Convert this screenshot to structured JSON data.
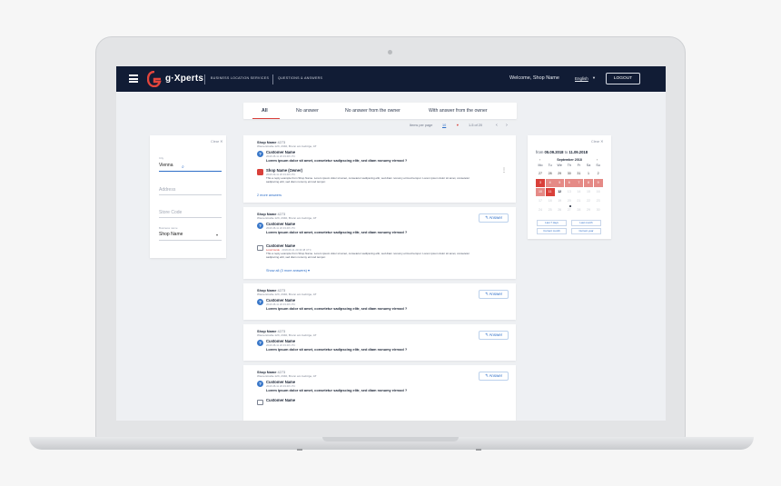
{
  "header": {
    "brand": "g·Xperts",
    "nav_items": [
      "BUSINESS LOCATION SERVICES",
      "QUESTIONS & ANSWERS"
    ],
    "welcome": "Welcome, Shop Name",
    "language": "English",
    "logout": "LOGOUT"
  },
  "tabs": [
    "All",
    "No answer",
    "No answer from the owner",
    "With answer from the owner"
  ],
  "pagination": {
    "per_page_label": "Items per page",
    "per_page_value": "10",
    "range": "1-5 of 20"
  },
  "filter": {
    "clear": "Clear",
    "city_label": "City",
    "city_value": "Vienna",
    "address_placeholder": "Address",
    "store_code_placeholder": "Store Code",
    "business_label": "Business name",
    "business_value": "Shop Name"
  },
  "questions": [
    {
      "shop": "Shop Name",
      "shop_id": "4273",
      "address": "Wienerstraße 123, 2340, Brunn am Gebirge, AT",
      "customer": "Customer Name",
      "date": "2018-08-11 20:33:48 UTC",
      "question": "Lorem ipsum dolor sit amet, consetetur sadipscing elitr, sed diam nonumy eirmod ?",
      "owner_name": "Shop Name (Owner)",
      "owner_date": "2018-09-11 20:33:48 UTC",
      "owner_answer": "This a reply example from Shop Name. Lorem ipsum dolor sit amet, consetetur sadipscing elitr, sed diam nonumy eirmod tempor. Lorem ipsum dolor sit amet, consetetur sadipscing elitr, sed diam nonumy eirmod tempor.",
      "more": "2 more answers"
    },
    {
      "shop": "Shop Name",
      "shop_id": "4273",
      "address": "Wienerstraße 123, 2340, Brunn am Gebirge, AT",
      "customer": "Customer Name",
      "date": "2018-08-11 20:33:48 UTC",
      "question": "Lorem ipsum dolor sit amet, consetetur sadipscing elitr, sed diam nonumy eirmod ?",
      "answer_btn": "Answer",
      "reply_name": "Customer Name",
      "reply_rank": "Local Guide",
      "reply_date": "2018-09-11 20:33:48 UTC",
      "reply_text": "This a reply example from Shop Name. Lorem ipsum dolor sit amet, consetetur sadipscing elitr, sed diam nonumy eirmod tempor. Lorem ipsum dolor sit amet, consetetur sadipscing elitr, sed diam nonumy eirmod tempor.",
      "more": "Show all (3 more answers)"
    },
    {
      "shop": "Shop Name",
      "shop_id": "4273",
      "address": "Wienerstraße 123, 2340, Brunn am Gebirge, AT",
      "customer": "Customer Name",
      "date": "2018-08-11 20:33:48 UTC",
      "question": "Lorem ipsum dolor sit amet, consetetur sadipscing elitr, sed diam nonumy eirmod ?",
      "answer_btn": "Answer"
    },
    {
      "shop": "Shop Name",
      "shop_id": "4273",
      "address": "Wienerstraße 123, 2340, Brunn am Gebirge, AT",
      "customer": "Customer Name",
      "date": "2018-08-11 20:33:48 UTC",
      "question": "Lorem ipsum dolor sit amet, consetetur sadipscing elitr, sed diam nonumy eirmod ?",
      "answer_btn": "Answer"
    },
    {
      "shop": "Shop Name",
      "shop_id": "4273",
      "address": "Wienerstraße 123, 2340, Brunn am Gebirge, AT",
      "customer": "Customer Name",
      "date": "2018-08-11 20:33:48 UTC",
      "question": "Lorem ipsum dolor sit amet, consetetur sadipscing elitr, sed diam nonumy eirmod ?",
      "answer_btn": "Answer",
      "next_customer": "Customer Name"
    }
  ],
  "calendar": {
    "clear": "Clear",
    "from_label": "from",
    "from": "05.09.2018",
    "to_label": "to",
    "to": "11.09.2018",
    "month": "September 2018",
    "weekdays": [
      "Mo",
      "Tu",
      "We",
      "Th",
      "Fr",
      "Sa",
      "Su"
    ],
    "weeks": [
      [
        "27",
        "28",
        "29",
        "30",
        "31",
        "1",
        "2"
      ],
      [
        "3",
        "4",
        "5",
        "6",
        "7",
        "8",
        "9"
      ],
      [
        "10",
        "11",
        "12",
        "13",
        "14",
        "15",
        "16"
      ],
      [
        "17",
        "18",
        "19",
        "20",
        "21",
        "22",
        "23"
      ],
      [
        "24",
        "25",
        "26",
        "27",
        "28",
        "29",
        "30"
      ]
    ],
    "quick": [
      "Last 7 days",
      "Last month",
      "Current month",
      "Current year"
    ]
  },
  "colors": {
    "navbar": "#111c35",
    "accent_red": "#d9403a",
    "link_blue": "#2d6ec8"
  }
}
